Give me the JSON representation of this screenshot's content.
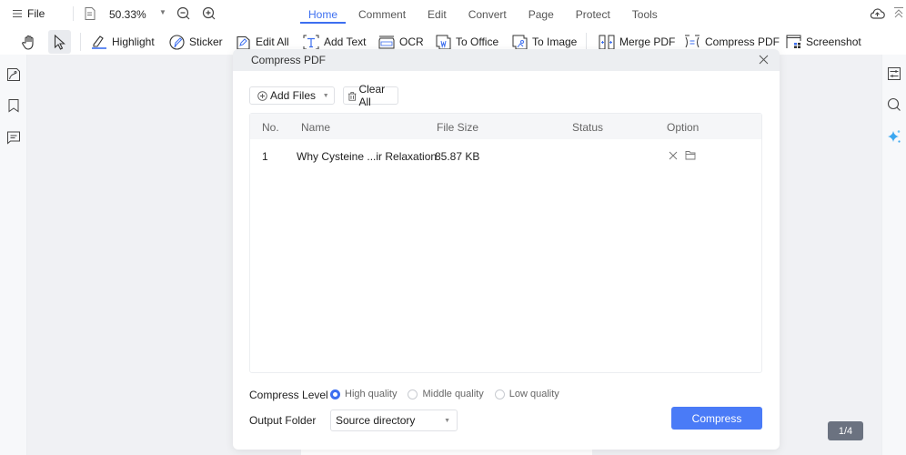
{
  "topbar": {
    "file_label": "File",
    "zoom_level": "50.33%",
    "tabs": [
      {
        "label": "Home",
        "active": true
      },
      {
        "label": "Comment",
        "active": false
      },
      {
        "label": "Edit",
        "active": false
      },
      {
        "label": "Convert",
        "active": false
      },
      {
        "label": "Page",
        "active": false
      },
      {
        "label": "Protect",
        "active": false
      },
      {
        "label": "Tools",
        "active": false
      }
    ]
  },
  "toolbar": {
    "highlight": "Highlight",
    "sticker": "Sticker",
    "edit_all": "Edit All",
    "add_text": "Add Text",
    "ocr": "OCR",
    "to_office": "To Office",
    "to_image": "To Image",
    "merge_pdf": "Merge PDF",
    "compress_pdf": "Compress PDF",
    "screenshot": "Screenshot"
  },
  "viewer": {
    "page_indicator": "1/4"
  },
  "dialog": {
    "title": "Compress PDF",
    "add_files": "Add Files",
    "clear_all": "Clear All",
    "columns": {
      "no": "No.",
      "name": "Name",
      "size": "File Size",
      "status": "Status",
      "option": "Option"
    },
    "rows": [
      {
        "no": "1",
        "name": "Why Cysteine ...ir Relaxation",
        "size": "85.87 KB",
        "status": ""
      }
    ],
    "compress_level_label": "Compress Level",
    "levels": [
      {
        "label": "High quality",
        "selected": true
      },
      {
        "label": "Middle quality",
        "selected": false
      },
      {
        "label": "Low quality",
        "selected": false
      }
    ],
    "output_folder_label": "Output Folder",
    "output_folder_value": "Source directory",
    "compress_button": "Compress"
  },
  "colors": {
    "accent": "#3d6ff0",
    "button": "#4a7bf7",
    "badge": "#6b7280"
  }
}
